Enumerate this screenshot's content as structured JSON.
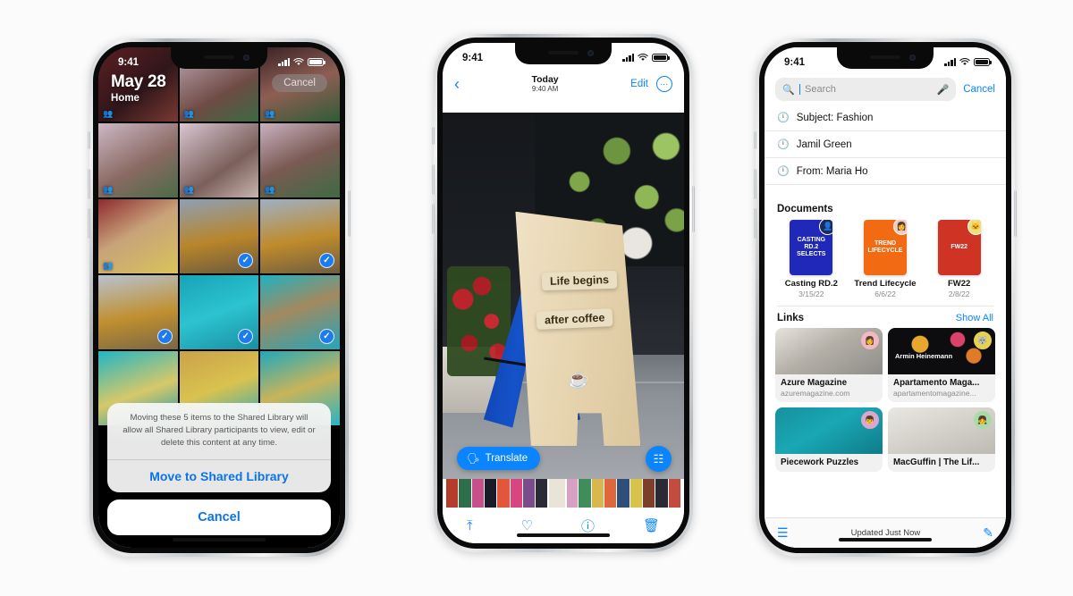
{
  "background_color": "#fbfbfb",
  "accent_color": "#0a84ff",
  "phones": {
    "photos_shared_library": {
      "status_bar": {
        "time": "9:41",
        "signal_icon": "cellular-bars-icon",
        "wifi_icon": "wifi-icon",
        "battery_icon": "battery-icon"
      },
      "overlay": {
        "date": "May 28",
        "place": "Home",
        "cancel_label": "Cancel"
      },
      "grid": {
        "cells": [
          {
            "id": "c1",
            "bg": "linear-gradient(140deg,#5c1f23,#30161a 55%,#7a3a33)",
            "shared": true,
            "selected": false
          },
          {
            "id": "c2",
            "bg": "linear-gradient(150deg,#c2a9b6,#6e4b45 60%,#3c6a40)",
            "shared": true,
            "selected": false
          },
          {
            "id": "c3",
            "bg": "linear-gradient(160deg,#3a2226,#8f5e53 50%,#2f5c37)",
            "shared": true,
            "selected": false
          },
          {
            "id": "c4",
            "bg": "linear-gradient(150deg,#cdb8c6,#8a6a63 55%,#4b6b45)",
            "shared": true,
            "selected": false
          },
          {
            "id": "c5",
            "bg": "linear-gradient(145deg,#d8c6d2,#7b5f5a 60%,#c8b6ae)",
            "shared": true,
            "selected": false
          },
          {
            "id": "c6",
            "bg": "linear-gradient(155deg,#c9b1c1,#7a5a53 50%,#3e6b42)",
            "shared": true,
            "selected": false
          },
          {
            "id": "c7",
            "bg": "linear-gradient(150deg,#8e2b2f,#c8a37a 45%,#d9c35a)",
            "shared": true,
            "selected": false
          },
          {
            "id": "c8",
            "bg": "linear-gradient(170deg,#8e9fb5,#b8852a 55%,#6b5a3e)",
            "shared": false,
            "selected": true
          },
          {
            "id": "c9",
            "bg": "linear-gradient(170deg,#9fb0c4,#bf8b2b 55%,#6f5d40)",
            "shared": false,
            "selected": true
          },
          {
            "id": "c10",
            "bg": "linear-gradient(170deg,#b8c2cf,#c08f2f 55%,#7a6745)",
            "shared": false,
            "selected": true
          },
          {
            "id": "c11",
            "bg": "linear-gradient(160deg,#17a3b8,#2cc3cf 50%,#1a8fa3)",
            "shared": false,
            "selected": true
          },
          {
            "id": "c12",
            "bg": "linear-gradient(160deg,#1fb2c2,#a3895f 45%,#23a6bb)",
            "shared": false,
            "selected": true
          },
          {
            "id": "c13",
            "bg": "linear-gradient(160deg,#21b5c4,#d7c86a 55%,#1a98ad)",
            "shared": false,
            "selected": false
          },
          {
            "id": "c14",
            "bg": "linear-gradient(160deg,#caa24a,#d9c24f 50%,#2aa8bd)",
            "shared": false,
            "selected": false
          },
          {
            "id": "c15",
            "bg": "linear-gradient(160deg,#1fa8bd,#c9b45a 50%,#2bb3c4)",
            "shared": false,
            "selected": false
          }
        ]
      },
      "action_sheet": {
        "message": "Moving these 5 items to the Shared Library will allow all Shared Library participants to view, edit or delete this content at any time.",
        "primary_label": "Move to Shared Library",
        "cancel_label": "Cancel"
      }
    },
    "photo_viewer_live_text": {
      "status_bar": {
        "time": "9:41",
        "signal_icon": "cellular-bars-icon",
        "wifi_icon": "wifi-icon",
        "battery_icon": "battery-icon"
      },
      "nav": {
        "back_icon": "chevron-left-icon",
        "title": "Today",
        "subtitle": "9:40 AM",
        "edit_label": "Edit",
        "more_icon": "ellipsis-circle-icon"
      },
      "photo": {
        "detected_text_line_1": "Life begins",
        "detected_text_line_2": "after coffee",
        "sign_glyph": "coffee-cup-icon"
      },
      "translate_button": {
        "label": "Translate",
        "icon": "translate-icon"
      },
      "live_text_button": {
        "icon": "live-text-scan-icon"
      },
      "filmstrip": {
        "thumbs": [
          "#b53c2a",
          "#2f6e4a",
          "#c94f8a",
          "#1a1a28",
          "#e2563b",
          "#d9457e",
          "#7a4c8c",
          "#2b2b38",
          "#e8e4d8",
          "#d8a0c2",
          "#3f8d5a",
          "#d9b64e",
          "#e0673c",
          "#2f4f7a",
          "#d7c24a",
          "#7d3f2a",
          "#2a2a35",
          "#c34b3f"
        ],
        "selected_index": 8
      },
      "tabbar": {
        "items": [
          {
            "name": "share-icon",
            "glyph": "↥"
          },
          {
            "name": "favorite-heart-icon",
            "glyph": "♡"
          },
          {
            "name": "info-icon",
            "glyph": "ⓘ"
          },
          {
            "name": "trash-icon",
            "glyph": "Ὕ1"
          }
        ]
      }
    },
    "mail_search": {
      "status_bar": {
        "time": "9:41",
        "signal_icon": "cellular-bars-icon",
        "wifi_icon": "wifi-icon",
        "battery_icon": "battery-icon"
      },
      "search": {
        "placeholder": "Search",
        "value": "",
        "search_icon": "magnifier-icon",
        "mic_icon": "microphone-icon",
        "cancel_label": "Cancel"
      },
      "suggestions": [
        {
          "icon": "recent-clock-icon",
          "label": "Subject: Fashion"
        },
        {
          "icon": "recent-clock-icon",
          "label": "Jamil Green"
        },
        {
          "icon": "recent-clock-icon",
          "label": "From: Maria Ho"
        }
      ],
      "documents_section": {
        "title": "Documents",
        "items": [
          {
            "name": "Casting RD.2",
            "date": "3/15/22",
            "cover_bg": "#1f28b8",
            "cover_text": "CASTING RD.2 SELECTS",
            "avatar_bg": "#1c2a5e",
            "avatar_glyph": "👤"
          },
          {
            "name": "Trend Lifecycle",
            "date": "6/6/22",
            "cover_bg": "#f26a12",
            "cover_text": "TREND LIFECYCLE",
            "avatar_bg": "#f6c9c0",
            "avatar_glyph": "👩"
          },
          {
            "name": "FW22",
            "date": "2/8/22",
            "cover_bg": "#cf3324",
            "cover_text": "FW22",
            "avatar_bg": "#efe07a",
            "avatar_glyph": "🐱"
          }
        ]
      },
      "links_section": {
        "title": "Links",
        "show_all_label": "Show All",
        "items": [
          {
            "title": "Azure Magazine",
            "url": "azuremagazine.com",
            "img_bg": "linear-gradient(150deg,#e6e3dd,#b4b0a8 45%,#8f8d88)",
            "avatar_ring": "#f2b8c6",
            "avatar_glyph": "👩"
          },
          {
            "title": "Apartamento Maga...",
            "url": "apartamentomagazine...",
            "img_bg": "radial-gradient(circle at 30% 35%,#e8a72e 0 10%,transparent 11%), radial-gradient(circle at 65% 25%,#d9426a 0 9%,transparent 10%), radial-gradient(circle at 80% 60%,#e07b2a 0 8%,transparent 9%), #0d0d10",
            "avatar_ring": "#e6d24f",
            "avatar_glyph": "🐺",
            "caption": "Armin Heinemann"
          },
          {
            "title": "Piecework Puzzles",
            "url": "",
            "img_bg": "linear-gradient(150deg,#16909e,#1aa7b4 45%,#0f7c88)",
            "avatar_ring": "#d9a7d0",
            "avatar_glyph": "👦"
          },
          {
            "title": "MacGuffin | The Lif...",
            "url": "",
            "img_bg": "linear-gradient(160deg,#e9e7e2,#d4d1ca 50%,#bdbab3)",
            "avatar_ring": "#a8dba8",
            "avatar_glyph": "👧"
          }
        ]
      },
      "toolbar": {
        "filter_icon": "filter-icon",
        "status_text": "Updated Just Now",
        "compose_icon": "compose-icon"
      }
    }
  }
}
